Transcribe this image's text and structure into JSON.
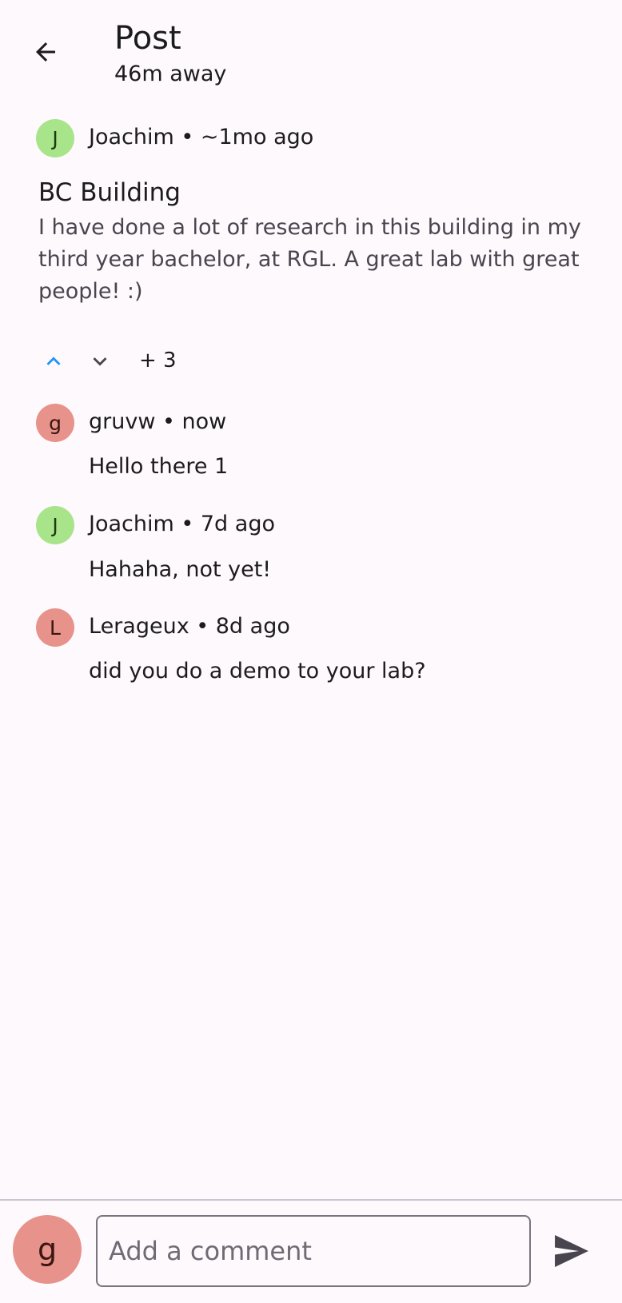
{
  "header": {
    "title": "Post",
    "subtitle": "46m away"
  },
  "post": {
    "author_initial": "J",
    "meta": "Joachim • ~1mo ago",
    "title": "BC Building",
    "body": "I have done a lot of research in this building in my third year bachelor, at RGL. A great lab with great people! :)",
    "score": "+ 3",
    "accent_color": "#2196f3"
  },
  "comments": [
    {
      "initial": "g",
      "meta": "gruvw • now",
      "text": "Hello there 1"
    },
    {
      "initial": "J",
      "meta": "Joachim • 7d ago",
      "text": "Hahaha, not yet!"
    },
    {
      "initial": "L",
      "meta": "Lerageux • 8d ago",
      "text": "did you do a demo to your lab?"
    }
  ],
  "composer": {
    "avatar_initial": "g",
    "placeholder": "Add a comment"
  }
}
